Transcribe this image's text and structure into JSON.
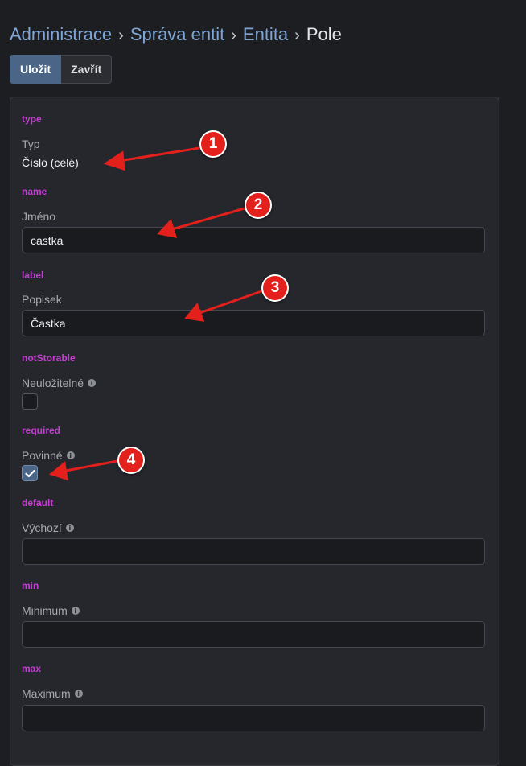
{
  "breadcrumb": {
    "items": [
      "Administrace",
      "Správa entit",
      "Entita"
    ],
    "current": "Pole",
    "separator": "›"
  },
  "toolbar": {
    "save_label": "Uložit",
    "close_label": "Zavřít"
  },
  "fields": {
    "type": {
      "key": "type",
      "label": "Typ",
      "value": "Číslo (celé)"
    },
    "name": {
      "key": "name",
      "label": "Jméno",
      "value": "castka"
    },
    "label": {
      "key": "label",
      "label": "Popisek",
      "value": "Častka"
    },
    "notStorable": {
      "key": "notStorable",
      "label": "Neuložitelné",
      "checked": false
    },
    "required": {
      "key": "required",
      "label": "Povinné",
      "checked": true
    },
    "default": {
      "key": "default",
      "label": "Výchozí",
      "value": ""
    },
    "min": {
      "key": "min",
      "label": "Minimum",
      "value": ""
    },
    "max": {
      "key": "max",
      "label": "Maximum",
      "value": ""
    }
  },
  "annotations": [
    "1",
    "2",
    "3",
    "4"
  ],
  "colors": {
    "accent": "#4a6585",
    "field_key": "#c43fd1",
    "annotation": "#e3201b",
    "link": "#7fa6d6"
  }
}
